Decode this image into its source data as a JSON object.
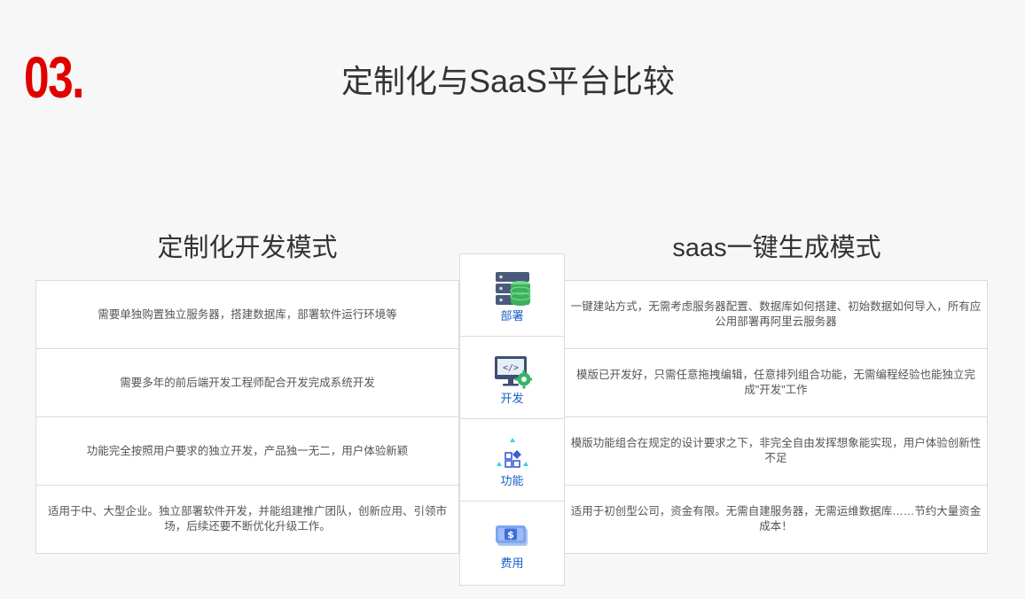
{
  "header": {
    "number": "03.",
    "title": "定制化与SaaS平台比较"
  },
  "columns": {
    "left_title": "定制化开发模式",
    "right_title": "saas一键生成模式"
  },
  "categories": [
    {
      "label": "部署",
      "icon": "server-database-icon"
    },
    {
      "label": "开发",
      "icon": "monitor-code-gear-icon"
    },
    {
      "label": "功能",
      "icon": "function-blocks-icon"
    },
    {
      "label": "费用",
      "icon": "money-bill-icon"
    }
  ],
  "rows": [
    {
      "left": "需要单独购置独立服务器，搭建数据库，部署软件运行环境等",
      "right": "一键建站方式，无需考虑服务器配置、数据库如何搭建、初始数据如何导入，所有应公用部署再阿里云服务器"
    },
    {
      "left": "需要多年的前后端开发工程师配合开发完成系统开发",
      "right": "模版已开发好，只需任意拖拽编辑，任意排列组合功能，无需编程经验也能独立完成\"开发\"工作"
    },
    {
      "left": "功能完全按照用户要求的独立开发，产品独一无二，用户体验新颖",
      "right": "模版功能组合在规定的设计要求之下，非完全自由发挥想象能实现，用户体验创新性不足"
    },
    {
      "left": "适用于中、大型企业。独立部署软件开发，并能组建推广团队，创新应用、引领市场，后续还要不断优化升级工作。",
      "right": "适用于初创型公司，资金有限。无需自建服务器，无需运维数据库……节约大量资金成本！"
    }
  ],
  "colors": {
    "accent_red": "#e00000",
    "label_blue": "#1a5fc8"
  }
}
